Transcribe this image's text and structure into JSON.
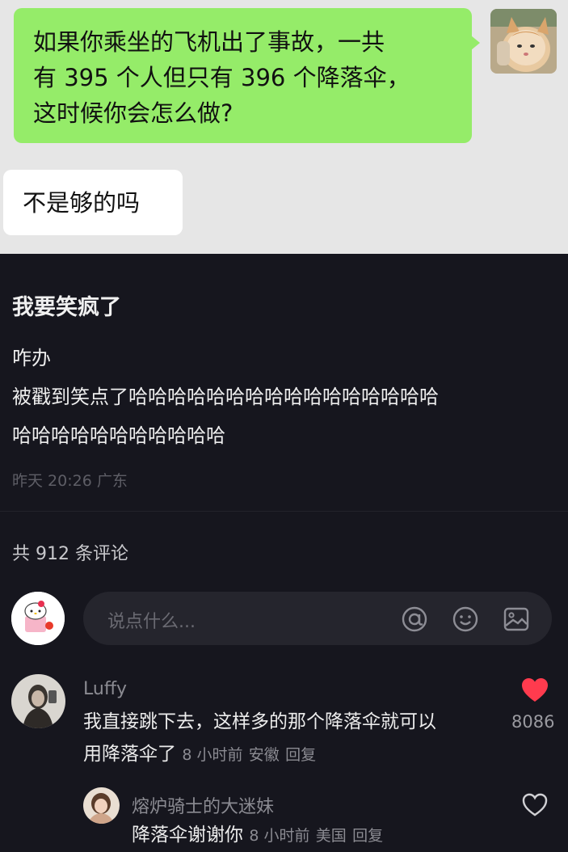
{
  "chat": {
    "question": [
      "如果你乘坐的飞机出了事故，一共",
      "有 395 个人但只有 396 个降落伞，",
      "这时候你会怎么做?"
    ],
    "reply": "不是够的吗"
  },
  "post": {
    "title": "我要笑疯了",
    "lines": [
      "咋办",
      "被戳到笑点了哈哈哈哈哈哈哈哈哈哈哈哈哈哈哈哈",
      "哈哈哈哈哈哈哈哈哈哈哈"
    ],
    "meta": "昨天 20:26 广东"
  },
  "comments_header": {
    "count_label": "共 912 条评论"
  },
  "input": {
    "placeholder": "说点什么...",
    "icons": [
      "at-icon",
      "emoji-icon",
      "image-icon"
    ]
  },
  "comments": [
    {
      "user": "Luffy",
      "text_line1": "我直接跳下去，这样多的那个降落伞就可以",
      "text_line2": "用降落伞了",
      "time": "8 小时前",
      "location": "安徽",
      "reply_label": "回复",
      "likes": "8086",
      "liked": true
    },
    {
      "user": "熔炉骑士的大迷妹",
      "text": "降落伞谢谢你",
      "time": "8 小时前",
      "location": "美国",
      "reply_label": "回复",
      "liked": false
    }
  ],
  "colors": {
    "bubble_green": "#95ec69",
    "like_red": "#ff3b4e",
    "background": "#16161e"
  }
}
